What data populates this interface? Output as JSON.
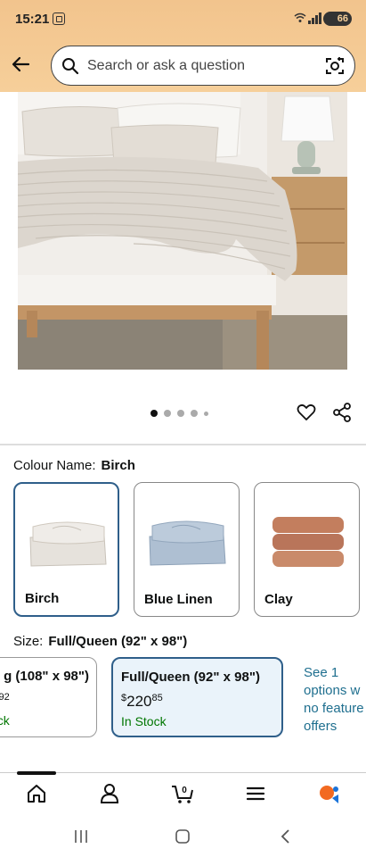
{
  "status_bar": {
    "time": "15:21",
    "battery": "66"
  },
  "search": {
    "placeholder": "Search or ask a question"
  },
  "product": {
    "colour_label": "Colour Name:",
    "colour_selected": "Birch",
    "colours": [
      {
        "name": "Birch",
        "selected": true,
        "color": "#e6e2dc"
      },
      {
        "name": "Blue Linen",
        "selected": false,
        "color": "#aebfd2"
      },
      {
        "name": "Clay",
        "selected": false,
        "color": "#c37e5e"
      }
    ],
    "size_label": "Size:",
    "size_selected": "Full/Queen (92\" x 98\")",
    "sizes": [
      {
        "name": "g (108\" x 98\")",
        "price_main": "8",
        "price_cents": "92",
        "stock": "ock"
      },
      {
        "name": "Full/Queen (92\" x 98\")",
        "currency": "$",
        "price_main": "220",
        "price_cents": "85",
        "stock": "In Stock"
      }
    ],
    "see_more": "See 1 options w no feature offers",
    "carousel_dots": 5,
    "carousel_active": 0
  },
  "colors": {
    "accent": "#2f5f8a",
    "header": "#f6cf9a",
    "stock_green": "#007600",
    "link": "#1f6f8f"
  }
}
